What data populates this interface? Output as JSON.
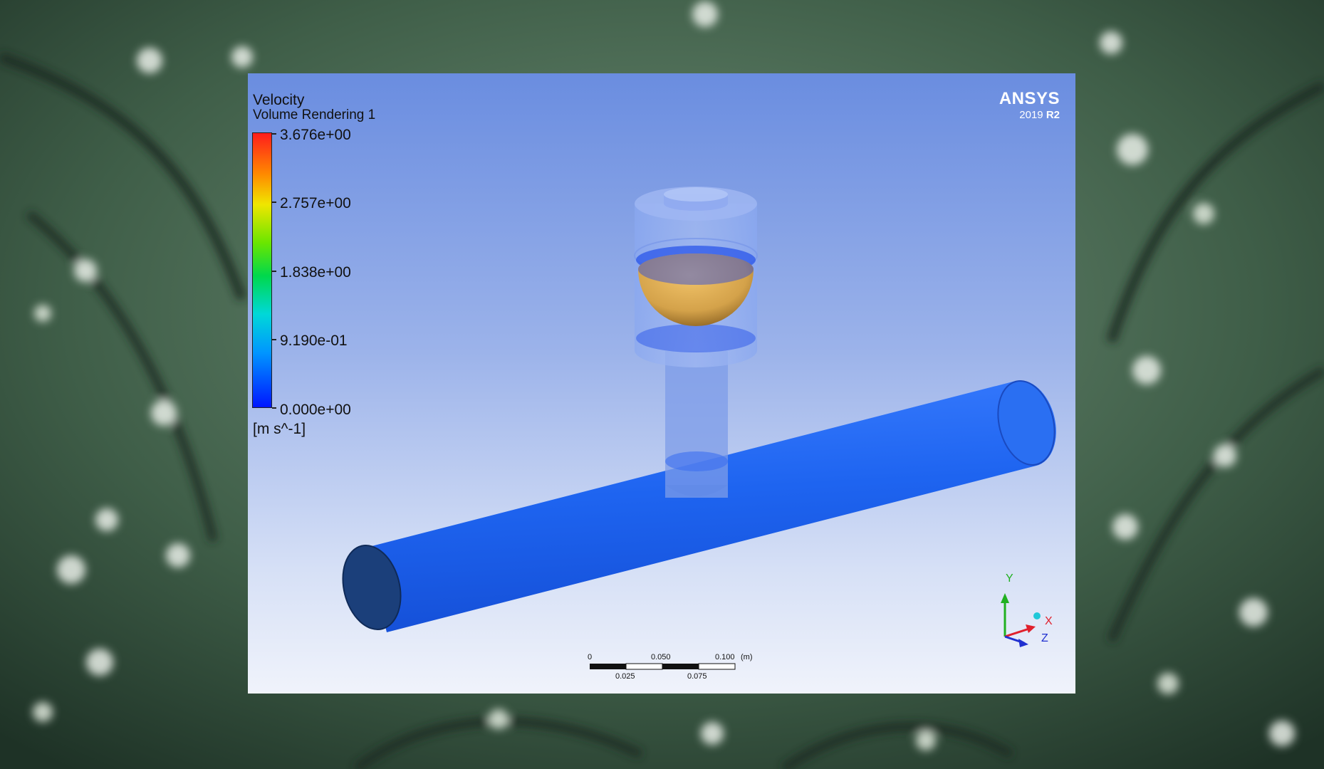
{
  "legend": {
    "variable": "Velocity",
    "object": "Volume Rendering 1",
    "ticks": [
      "3.676e+00",
      "2.757e+00",
      "1.838e+00",
      "9.190e-01",
      "0.000e+00"
    ],
    "units": "[m s^-1]",
    "min": 0,
    "max": 3.676
  },
  "brand": {
    "name": "ANSYS",
    "version_year": "2019",
    "version_release": "R2"
  },
  "scale_bar": {
    "top_labels": [
      "0",
      "0.050",
      "0.100"
    ],
    "unit": "(m)",
    "bottom_labels": [
      "0.025",
      "0.075"
    ]
  },
  "triad": {
    "y": "Y",
    "x": "X",
    "z": "Z"
  },
  "colors": {
    "pipe": "#1e64f0",
    "ball": "#d4a24a",
    "x_axis": "#e0202c",
    "y_axis": "#20b020",
    "z_axis": "#2030d0"
  }
}
